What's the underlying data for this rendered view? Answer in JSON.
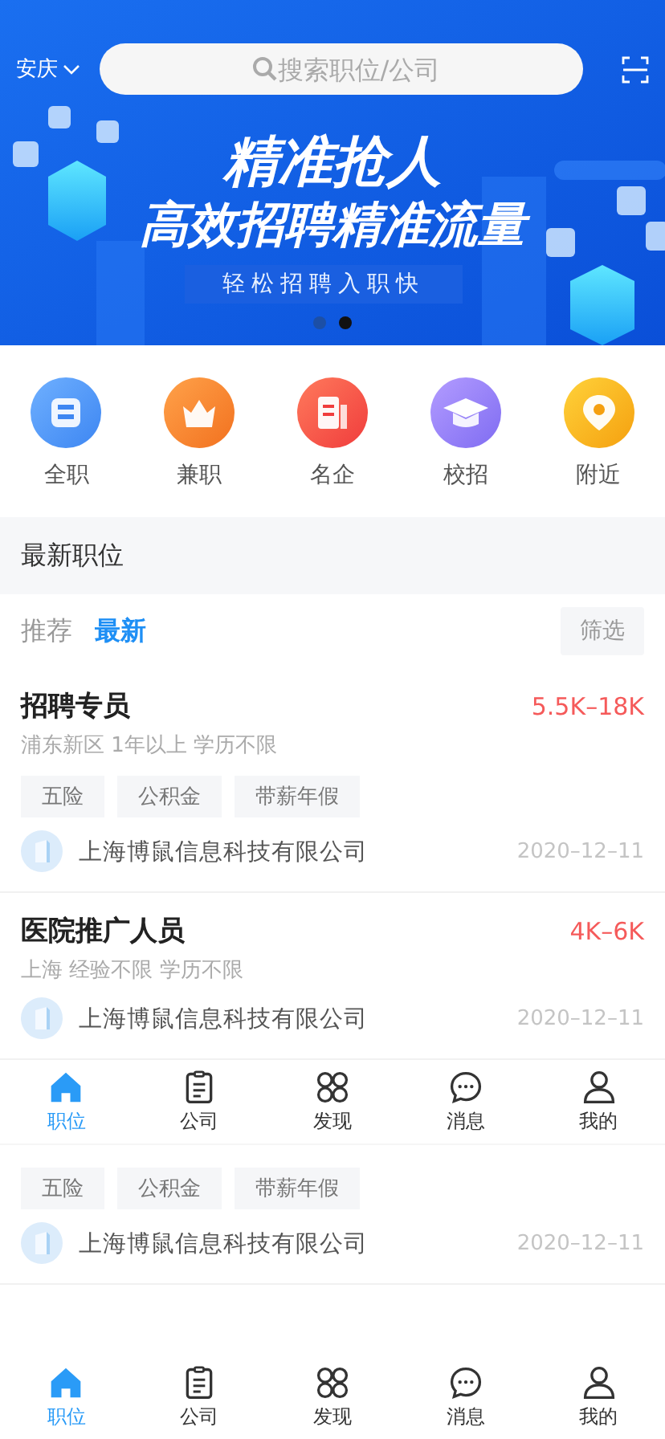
{
  "header": {
    "city": "安庆",
    "search": {
      "placeholder": "搜索职位/公司"
    }
  },
  "banner": {
    "headline": "精准抢人",
    "subheadline": "高效招聘精准流量",
    "tagline": "轻松招聘入职快",
    "dots": [
      {
        "selected": false
      },
      {
        "selected": true
      }
    ]
  },
  "categories": [
    {
      "label": "全职"
    },
    {
      "label": "兼职"
    },
    {
      "label": "名企"
    },
    {
      "label": "校招"
    },
    {
      "label": "附近"
    }
  ],
  "section": {
    "title": "最新职位"
  },
  "filter_tabs": [
    {
      "label": "推荐",
      "selected": false
    },
    {
      "label": "最新",
      "selected": true
    }
  ],
  "filter_button": "筛选",
  "jobs_top": [
    {
      "title": "招聘专员",
      "salary": "5.5K–18K",
      "meta": "浦东新区 1年以上 学历不限",
      "tags": [
        "五险",
        "公积金",
        "带薪年假"
      ],
      "company": "上海博鼠信息科技有限公司",
      "date": "2020–12–11"
    },
    {
      "title": "医院推广人员",
      "salary": "4K–6K",
      "meta": "上海 经验不限 学历不限",
      "company": "上海博鼠信息科技有限公司",
      "date": "2020–12–11"
    }
  ],
  "tab_bar_overlay": {
    "items": [
      {
        "label": "职位",
        "selected": true
      },
      {
        "label": "公司",
        "selected": false
      },
      {
        "label": "发现",
        "selected": false
      },
      {
        "label": "消息",
        "selected": false
      },
      {
        "label": "我的",
        "selected": false
      }
    ]
  },
  "jobs_bottom": [
    {
      "tags": [
        "五险",
        "公积金",
        "带薪年假"
      ],
      "company": "上海博鼠信息科技有限公司",
      "date": "2020–12–11"
    }
  ],
  "tab_bar": {
    "items": [
      {
        "label": "职位",
        "selected": true
      },
      {
        "label": "公司",
        "selected": false
      },
      {
        "label": "发现",
        "selected": false
      },
      {
        "label": "消息",
        "selected": false
      },
      {
        "label": "我的",
        "selected": false
      }
    ]
  }
}
